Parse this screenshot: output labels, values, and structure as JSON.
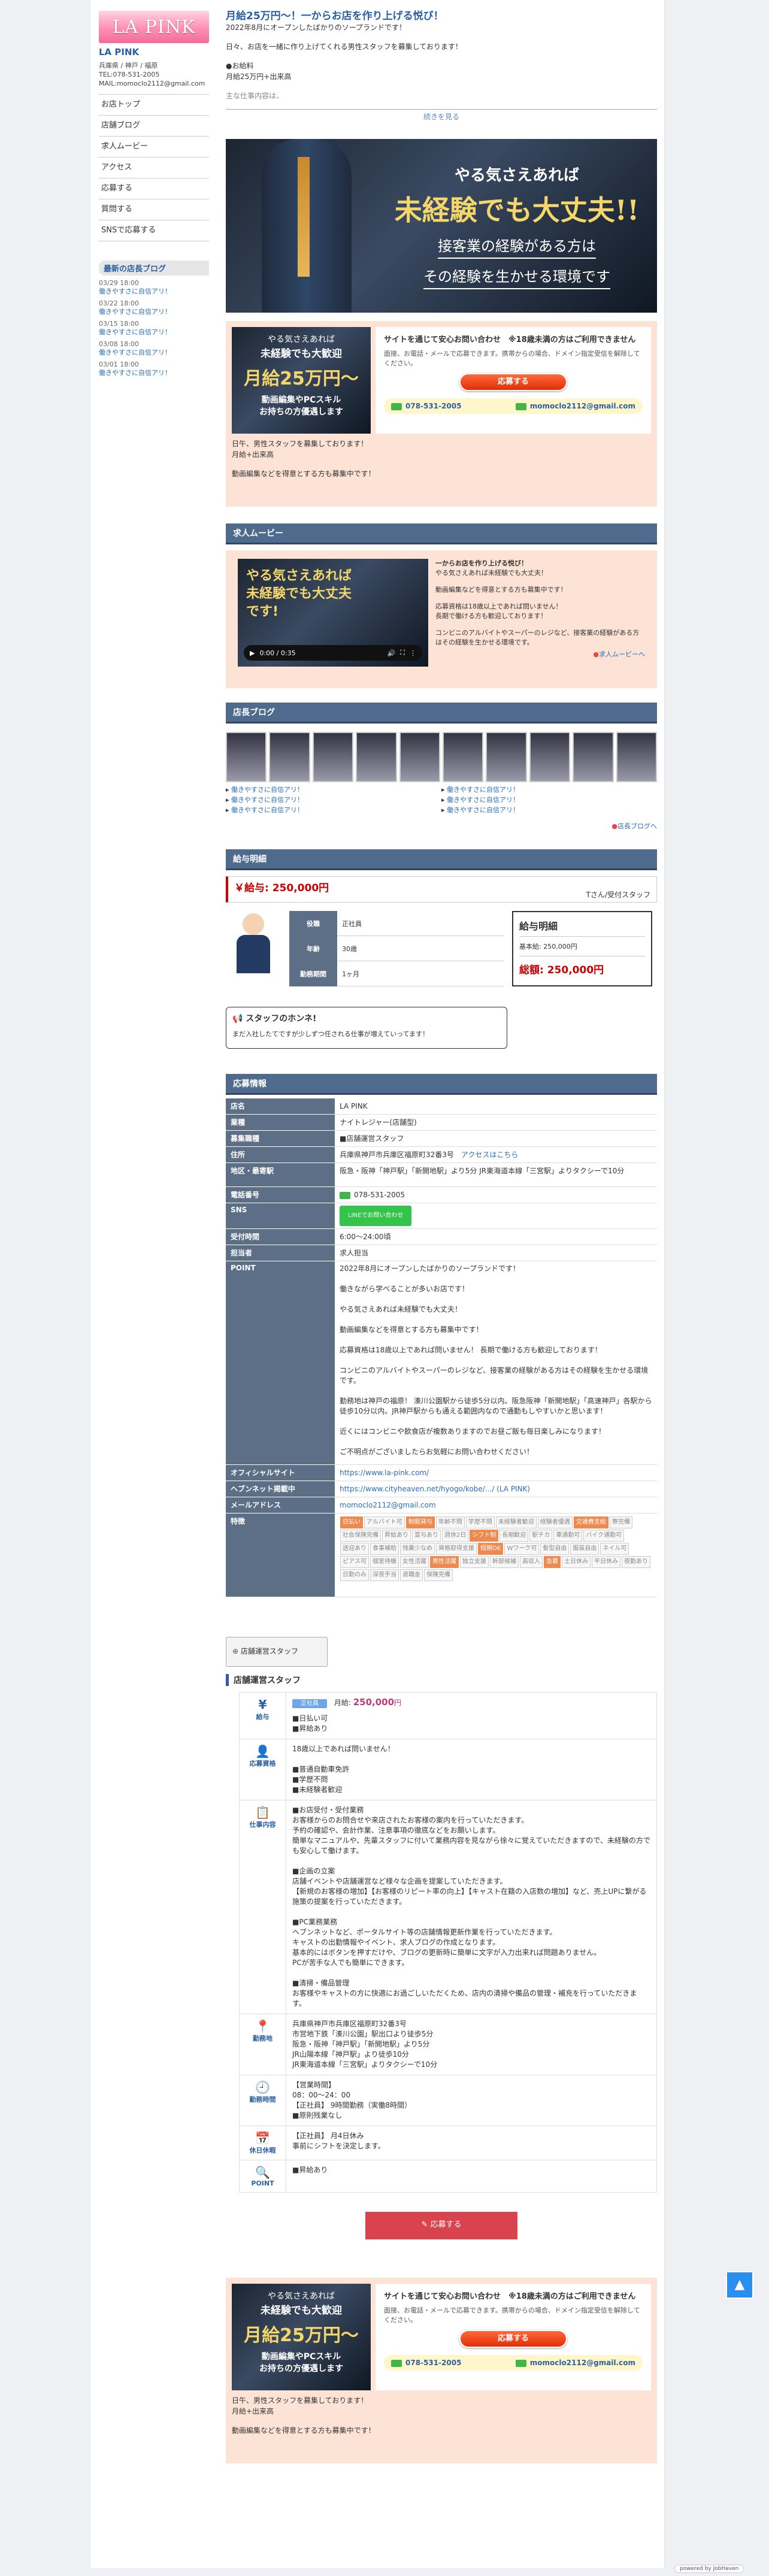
{
  "sidebar": {
    "logo": "LA PINK",
    "shop_name": "LA PINK",
    "address": "兵庫県 / 神戸 / 福原",
    "tel": "TEL:078-531-2005",
    "mail": "MAIL:momoclo2112@gmail.com",
    "menu": [
      "お店トップ",
      "店舗ブログ",
      "求人ムービー",
      "アクセス",
      "応募する",
      "質問する",
      "SNSで応募する"
    ],
    "blog_title": "最新の店長ブログ",
    "blog": [
      {
        "date": "03/29 18:00",
        "title": "働きやすさに自信アリ！"
      },
      {
        "date": "03/22 18:00",
        "title": "働きやすさに自信アリ！"
      },
      {
        "date": "03/15 18:00",
        "title": "働きやすさに自信アリ！"
      },
      {
        "date": "03/08 18:00",
        "title": "働きやすさに自信アリ！"
      },
      {
        "date": "03/01 18:00",
        "title": "働きやすさに自信アリ！"
      }
    ]
  },
  "intro": {
    "title": "月給25万円〜！一からお店を作り上げる悦び！",
    "opened": "2022年8月にオープンしたばかりのソープランドです！",
    "line1": "日々、お店を一緒に作り上げてくれる男性スタッフを募集しております！",
    "bullet1": "●お給料",
    "line2": "月給25万円+出来高",
    "line3": "主な仕事内容は、",
    "more": "続きを見る"
  },
  "hero": {
    "line1": "やる気さえあれば",
    "line2": "未経験でも大丈夫!!",
    "line3": "接客業の経験がある方は",
    "line4": "その経験を生かせる環境です"
  },
  "cta": {
    "banner_line1": "やる気さえあれば",
    "banner_line2": "未経験でも大歓迎",
    "banner_salary": "月給25万円〜",
    "banner_line3": "動画編集やPCスキル",
    "banner_line4": "お持ちの方優遇します",
    "notice_title": "サイトを通じて安心お問い合わせ",
    "notice_age": "※18歳未満の方はご利用できません",
    "notice_body": "面接、お電話・メールで応募できます。携帯からの場合、ドメイン指定受信を解除してください。",
    "apply": "応募する",
    "phone": "078-531-2005",
    "email": "momoclo2112@gmail.com",
    "text1": "日午、男性スタッフを募集しております！",
    "text2": "月給+出来高",
    "text3": "動画編集などを得意とする方も募集中です！"
  },
  "movie": {
    "head": "求人ムービー",
    "video_title": "やる気さえあれば 未経験でも大丈夫です!",
    "time": "0:00 / 0:35",
    "title": "一からお店を作り上げる悦び！",
    "lines": [
      "やる気さえあれば未経験でも大丈夫！",
      "動画編集などを得意とする方も募集中です！",
      "応募資格は18歳以上であれば問いません！",
      "長期で働ける方も歓迎しております！",
      "コンビニのアルバイトやスーパーのレジなど、接客業の経験がある方はその経験を生かせる環境です。"
    ],
    "more": "求人ムービーへ"
  },
  "blog": {
    "head": "店長ブログ",
    "posts": [
      "働きやすさに自信アリ！",
      "働きやすさに自信アリ！",
      "働きやすさに自信アリ！",
      "働きやすさに自信アリ！",
      "働きやすさに自信アリ！",
      "働きやすさに自信アリ！"
    ],
    "more": "店長ブログへ"
  },
  "salary": {
    "head": "給与明細",
    "amount": "￥給与: 250,000円",
    "staff": "Tさん/受付スタッフ",
    "rows": [
      {
        "k": "役職",
        "v": "正社員"
      },
      {
        "k": "年齢",
        "v": "30歳"
      },
      {
        "k": "勤務期間",
        "v": "1ヶ月"
      }
    ],
    "slip_title": "給与明細",
    "base_label": "基本給: 250,000円",
    "total": "総額: 250,000円",
    "voice_title": "スタッフのホンネ!",
    "voice": "まだ入社したてですが少しずつ任される仕事が増えていってます！"
  },
  "apply_info": {
    "head": "応募情報",
    "rows": [
      {
        "k": "店名",
        "v": "LA PINK"
      },
      {
        "k": "業種",
        "v": "ナイトレジャー(店舗型)"
      },
      {
        "k": "募集職種",
        "v": "■店舗運営スタッフ"
      },
      {
        "k": "住所",
        "v": "兵庫県神戸市兵庫区福原町32番3号",
        "link": "アクセスはこちら"
      },
      {
        "k": "地区・最寄駅",
        "v": "阪急・阪神「神戸駅」「新開地駅」より5分 JR東海道本線「三宮駅」よりタクシーで10分"
      },
      {
        "k": "電話番号",
        "v": "078-531-2005"
      },
      {
        "k": "SNS",
        "v": "LINEでお問い合わせ"
      },
      {
        "k": "受付時間",
        "v": "6:00〜24:00頃"
      },
      {
        "k": "担当者",
        "v": "求人担当"
      }
    ],
    "point_label": "POINT",
    "point": [
      "2022年8月にオープンしたばかりのソープランドです！",
      "働きながら学べることが多いお店です！",
      "やる気さえあれば未経験でも大丈夫！",
      "動画編集などを得意とする方も募集中です！",
      "応募資格は18歳以上であれば問いません！ 長期で働ける方も歓迎しております！",
      "コンビニのアルバイトやスーパーのレジなど、接客業の経験がある方はその経験を生かせる環境です。",
      "勤務地は神戸の福原！ 湊川公園駅から徒歩5分以内。阪急阪神「新開地駅」「高速神戸」各駅から徒歩10分以内。JR神戸駅からも通える範囲内なので通勤もしやすいかと思います！",
      "近くにはコンビニや飲食店が複数ありますのでお昼ご飯も毎日楽しみになります！",
      "ご不明点がございましたらお気軽にお問い合わせください！"
    ],
    "site_label": "オフィシャルサイト",
    "site": "https://www.la-pink.com/",
    "heaven_label": "ヘブンネット掲載中",
    "heaven": "https://www.cityheaven.net/hyogo/kobe/.../ (LA PINK)",
    "mail_label": "メールアドレス",
    "mail": "momoclo2112@gmail.com",
    "feature_label": "特徴",
    "tags": [
      [
        "日払い",
        1
      ],
      [
        "アルバイト可",
        0
      ],
      [
        "制服貸与",
        1
      ],
      [
        "年齢不問",
        0
      ],
      [
        "学歴不問",
        0
      ],
      [
        "未経験者歓迎",
        0
      ],
      [
        "経験者優遇",
        0
      ],
      [
        "交通費支給",
        1
      ],
      [
        "寮完備",
        0
      ],
      [
        "社会保険完備",
        0
      ],
      [
        "昇給あり",
        0
      ],
      [
        "賞与あり",
        0
      ],
      [
        "週休2日",
        0
      ],
      [
        "シフト制",
        1
      ],
      [
        "長期歓迎",
        0
      ],
      [
        "駅チカ",
        0
      ],
      [
        "車通勤可",
        0
      ],
      [
        "バイク通勤可",
        0
      ],
      [
        "送迎あり",
        0
      ],
      [
        "食事補助",
        0
      ],
      [
        "残業少なめ",
        0
      ],
      [
        "資格取得支援",
        0
      ],
      [
        "短期OK",
        1
      ],
      [
        "Wワーク可",
        0
      ],
      [
        "髪型自由",
        0
      ],
      [
        "服装自由",
        0
      ],
      [
        "ネイル可",
        0
      ],
      [
        "ピアス可",
        0
      ],
      [
        "個室待機",
        0
      ],
      [
        "女性活躍",
        0
      ],
      [
        "男性活躍",
        1
      ],
      [
        "独立支援",
        0
      ],
      [
        "幹部候補",
        0
      ],
      [
        "高収入",
        0
      ],
      [
        "急募",
        1
      ],
      [
        "土日休み",
        0
      ],
      [
        "平日休み",
        0
      ],
      [
        "夜勤あり",
        0
      ],
      [
        "日勤のみ",
        0
      ],
      [
        "深夜手当",
        0
      ],
      [
        "退職金",
        0
      ],
      [
        "保険完備",
        0
      ]
    ]
  },
  "job": {
    "tab": "店舗運営スタッフ",
    "title": "店舗運営スタッフ",
    "salary_icon": "給与",
    "badge": "正社員",
    "salary_label": "月給:",
    "salary": "250,000",
    "salary_unit": "円",
    "salary_notes": [
      "■日払い可",
      "■昇給あり"
    ],
    "qual_label": "応募資格",
    "qual": [
      "18歳以上であれば問いません！",
      "■普通自動車免許",
      "■学歴不問",
      "■未経験者歓迎"
    ],
    "work_label": "仕事内容",
    "work": [
      "■お店受付・受付業務",
      "お客様からのお問合せや来店されたお客様の案内を行っていただきます。",
      "予約の確認や、会計作業、注意事項の徹底などをお願いします。",
      "簡単なマニュアルや、先輩スタッフに付いて業務内容を見ながら徐々に覚えていただきますので、未経験の方でも安心して働けます。",
      "■企画の立案",
      "店舗イベントや店舗運営など様々な企画を提案していただきます。",
      "【新規のお客様の増加】【お客様のリピート率の向上】【キャスト在籍の入店数の増加】など、売上UPに繋がる施策の提案を行っていただきます。",
      "■PC業務業務",
      "ヘブンネットなど、ポータルサイト等の店舗情報更新作業を行っていただきます。",
      "キャストの出勤情報やイベント、求人ブログの作成となります。",
      "基本的にはボタンを押すだけや、ブログの更新時に簡単に文字が入力出来れば問題ありません。",
      "PCが苦手な人でも簡単にできます。",
      "■清掃・備品管理",
      "お客様やキャストの方に快適にお過ごしいただくため、店内の清掃や備品の管理・補充を行っていただきます。"
    ],
    "place_label": "勤務地",
    "place": [
      "兵庫県神戸市兵庫区福原町32番3号",
      "市営地下鉄「湊川公園」駅出口より徒歩5分",
      "阪急・阪神「神戸駅」「新開地駅」より5分",
      "JR山陽本線「神戸駅」より徒歩10分",
      "JR東海道本線「三宮駅」よりタクシーで10分"
    ],
    "time_label": "勤務時間",
    "time": [
      "【営業時間】",
      "08：00〜24：00",
      "【正社員】 9時間勤務（実働8時間）",
      "■原則残業なし",
      "【正社員】 月4日休み",
      "事前にシフトを決定します。"
    ],
    "holiday_label": "休日休暇",
    "point_label": "POINT",
    "point": [
      "■昇給あり"
    ],
    "apply": "応募する"
  },
  "footer": {
    "powered": "powered by JobHaven"
  }
}
